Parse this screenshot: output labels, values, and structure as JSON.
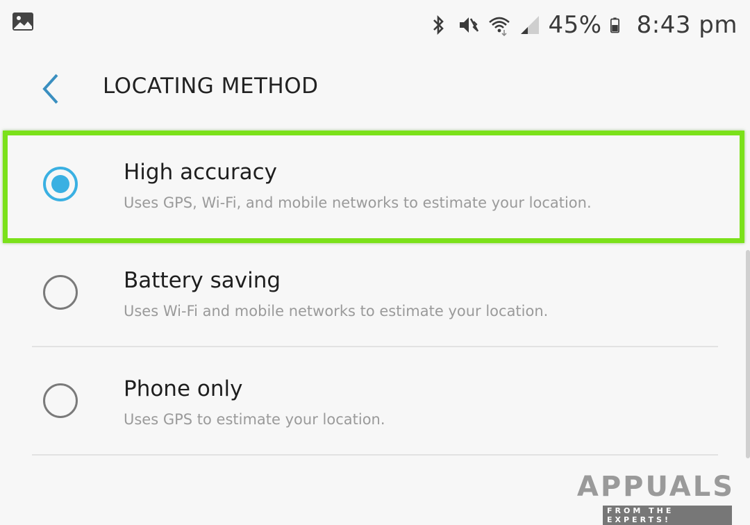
{
  "status_bar": {
    "battery_percent": "45%",
    "time": "8:43 pm",
    "icons": [
      "gallery-icon",
      "bluetooth-icon",
      "vibrate-icon",
      "wifi-icon",
      "signal-icon",
      "battery-icon"
    ]
  },
  "header": {
    "title": "LOCATING METHOD",
    "back_icon": "chevron-left-icon"
  },
  "options": [
    {
      "title": "High accuracy",
      "description": "Uses GPS, Wi-Fi, and mobile networks to estimate your location.",
      "selected": true
    },
    {
      "title": "Battery saving",
      "description": "Uses Wi-Fi and mobile networks to estimate your location.",
      "selected": false
    },
    {
      "title": "Phone only",
      "description": "Uses GPS to estimate your location.",
      "selected": false
    }
  ],
  "colors": {
    "accent": "#3ab0e2",
    "highlight": "#7be11a"
  },
  "watermark": {
    "brand": "APPUALS",
    "tagline": "FROM THE EXPERTS!"
  }
}
